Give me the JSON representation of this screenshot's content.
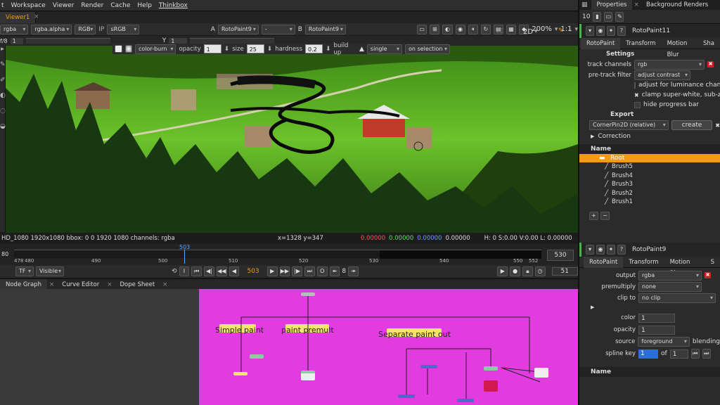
{
  "menu": {
    "items": [
      "t",
      "Workspace",
      "Viewer",
      "Render",
      "Cache",
      "Help",
      "Thinkbox"
    ]
  },
  "viewer": {
    "tab": "Viewer1",
    "channels": "rgba",
    "channel_alpha": "rgba.alpha",
    "display": "RGB",
    "ip": "IP",
    "colorspace": "sRGB",
    "input_a": "RotoPaint9",
    "input_a_letter": "A",
    "blend_dash": "-",
    "input_b_letter": "B",
    "input_b": "RotoPaint9",
    "zoom": "200%",
    "ratio": "1:1",
    "view_mode": "2D",
    "fstop": "f/8",
    "frame_field": "1",
    "y_label": "Y",
    "y_value": "1",
    "paint": {
      "blend": "color-burn",
      "opacity_label": "opacity",
      "opacity": "1",
      "size_label": "size",
      "size": "25",
      "hardness_label": "hardness",
      "hardness": "0.2",
      "buildup_label": "build up",
      "mode": "single",
      "selection": "on selection"
    },
    "info": {
      "format": "HD_1080 1920x1080  bbox: 0 0 1920 1080 channels: rgba",
      "coords": "x=1328 y=347",
      "r": "0.00000",
      "g": "0.00000",
      "b": "0.00000",
      "a": "0.00000",
      "hsvl": "H:   0 S:0.00 V:0.00   L: 0.00000"
    }
  },
  "timeline": {
    "start_marker": "80",
    "ticks": [
      "478",
      "480",
      "490",
      "500",
      "510",
      "520",
      "530",
      "540",
      "550",
      "552"
    ],
    "current_marker": "503",
    "end_field": "530",
    "current_frame": "503",
    "step": "8",
    "fps": "51",
    "tf": "TF",
    "visible": "Visible"
  },
  "graph": {
    "tabs": [
      "Node Graph",
      "Curve Editor",
      "Dope Sheet"
    ],
    "sticky_notes": [
      "Simple paint",
      "paint premult",
      "Separate paint out"
    ]
  },
  "properties": {
    "tabs": [
      "Properties",
      "Background Renders"
    ],
    "count": "10",
    "node1": {
      "name": "RotoPaint11",
      "tabs": [
        "RotoPaint",
        "Transform",
        "Motion Blur",
        "Sha"
      ],
      "section": "Settings",
      "track_channels_label": "track channels",
      "track_channels": "rgb",
      "pretrack_label": "pre-track filter",
      "pretrack": "adjust contrast",
      "adjust_lum": "adjust for luminance chang",
      "clamp": "clamp super-white, sub-zer",
      "hide_progress": "hide progress bar",
      "export_label": "Export",
      "export_value": "CornerPin2D (relative)",
      "create": "create",
      "correction": "Correction",
      "tree_header": "Name",
      "root": "Root",
      "brushes": [
        "Brush5",
        "Brush4",
        "Brush3",
        "Brush2",
        "Brush1"
      ]
    },
    "node2": {
      "name": "RotoPaint9",
      "tabs": [
        "RotoPaint",
        "Transform",
        "Motion Blur",
        "S"
      ],
      "output_label": "output",
      "output": "rgba",
      "premult_label": "premultiply",
      "premult": "none",
      "clip_label": "clip to",
      "clip": "no clip",
      "color_label": "color",
      "color": "1",
      "opacity_label": "opacity",
      "opacity": "1",
      "source_label": "source",
      "source": "foreground",
      "blending_label": "blending",
      "spline_label": "spline key",
      "spline": "1",
      "of_label": "of",
      "of_value": "1",
      "tree_header": "Name"
    }
  },
  "colors": {
    "accent": "#f39c12",
    "magenta": "#e23be0",
    "panel": "#2b2b2b"
  }
}
